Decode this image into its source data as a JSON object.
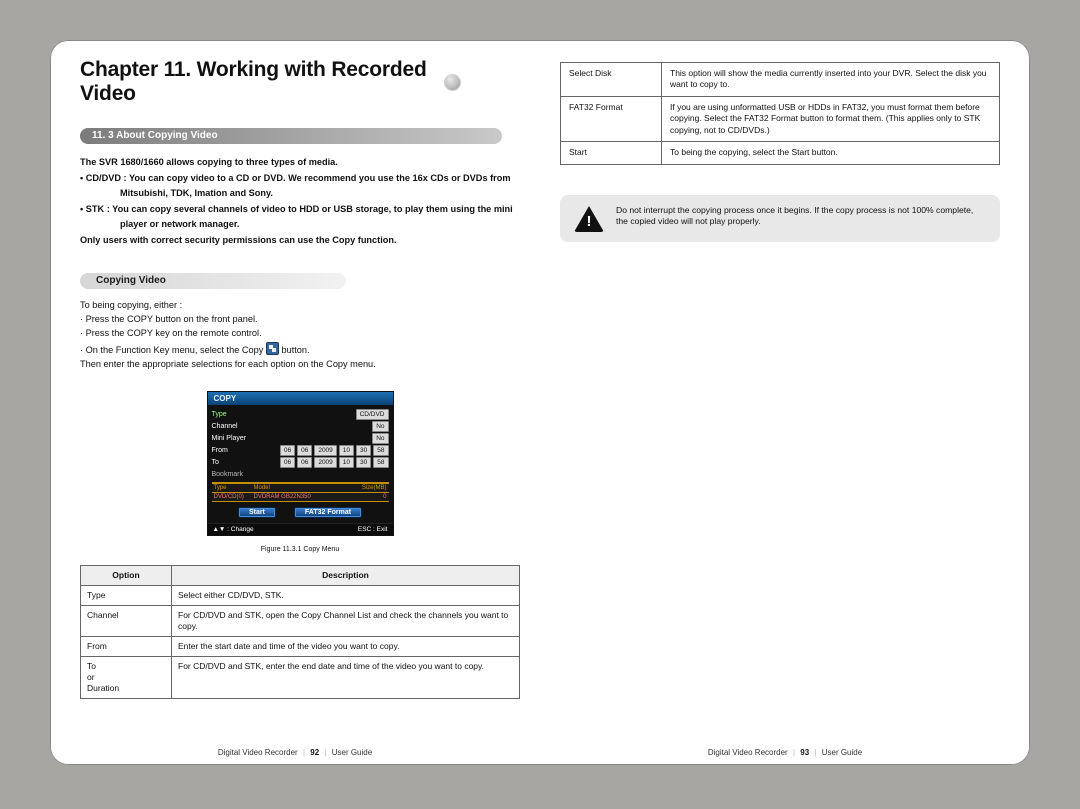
{
  "chapter": {
    "title": "Chapter 11. Working with Recorded Video"
  },
  "section": {
    "heading": "11. 3 About Copying Video"
  },
  "intro": {
    "lead": "The SVR 1680/1660 allows copying to three types of media.",
    "b1": "• CD/DVD : You can copy video to a CD or DVD. We recommend you use the 16x CDs or DVDs from",
    "b1b": "Mitsubishi, TDK, Imation and Sony.",
    "b2": "• STK : You can copy several channels of video to HDD or USB storage, to play them using the mini",
    "b2b": "player or network manager.",
    "note": "Only users with correct security permissions can use the Copy function."
  },
  "sub": {
    "heading": "Copying Video"
  },
  "steps": {
    "s0": "To being copying, either :",
    "s1": "· Press the COPY button on the front panel.",
    "s2": "· Press the COPY key on the remote control.",
    "s3a": "· On the Function Key menu, select the Copy",
    "s3b": "button.",
    "s4": "Then enter the appropriate selections for each option on the Copy menu."
  },
  "copy_menu": {
    "title": "COPY",
    "rows": {
      "type": {
        "label": "Type",
        "value": "CD/DVD"
      },
      "channel": {
        "label": "Channel",
        "value": "No"
      },
      "mini": {
        "label": "Mini Player",
        "value": "No"
      },
      "from": {
        "label": "From",
        "v1": "06",
        "v2": "06",
        "v3": "2009",
        "v4": "10",
        "v5": "30",
        "v6": "58"
      },
      "to": {
        "label": "To",
        "v1": "06",
        "v2": "06",
        "v3": "2009",
        "v4": "10",
        "v5": "30",
        "v6": "58"
      },
      "bookmark": {
        "label": "Bookmark"
      }
    },
    "table": {
      "h1": "Type",
      "h2": "Model",
      "h3": "Size(MB)",
      "c1": "DVD/CD(0)",
      "c2": "DVDRAM GB22N350",
      "c3": "0"
    },
    "btn1": "Start",
    "btn2": "FAT32 Format",
    "foot1": "▲▼ : Change",
    "foot2": "ESC : Exit"
  },
  "caption": "Figure 11.3.1 Copy Menu",
  "options_table": {
    "h1": "Option",
    "h2": "Description",
    "rows": [
      {
        "k": "Type",
        "v": "Select either CD/DVD, STK."
      },
      {
        "k": "Channel",
        "v": "For CD/DVD and STK, open the Copy Channel List and check the channels you want to copy."
      },
      {
        "k": "From",
        "v": "Enter the start date and time of the video you want to copy."
      },
      {
        "k": "To\nor\nDuration",
        "v": "For CD/DVD and STK, enter the end date and time of the video you want to copy."
      }
    ]
  },
  "right_table": {
    "rows": [
      {
        "k": "Select Disk",
        "v": "This option will show the media currently inserted into your DVR. Select the disk you want to copy to."
      },
      {
        "k": "FAT32 Format",
        "v": "If you are using unformatted USB or HDDs in FAT32, you must format them before copying. Select the FAT32 Format button to format them. (This applies only to STK copying, not to CD/DVDs.)"
      },
      {
        "k": "Start",
        "v": "To being the copying, select the Start button."
      }
    ]
  },
  "warning": {
    "text": "Do not interrupt the copying process once it begins. If the copy process is not 100% complete, the copied video will not play properly."
  },
  "footer": {
    "left_a": "Digital Video Recorder",
    "left_n": "92",
    "left_b": "User Guide",
    "right_a": "Digital Video Recorder",
    "right_n": "93",
    "right_b": "User Guide"
  }
}
